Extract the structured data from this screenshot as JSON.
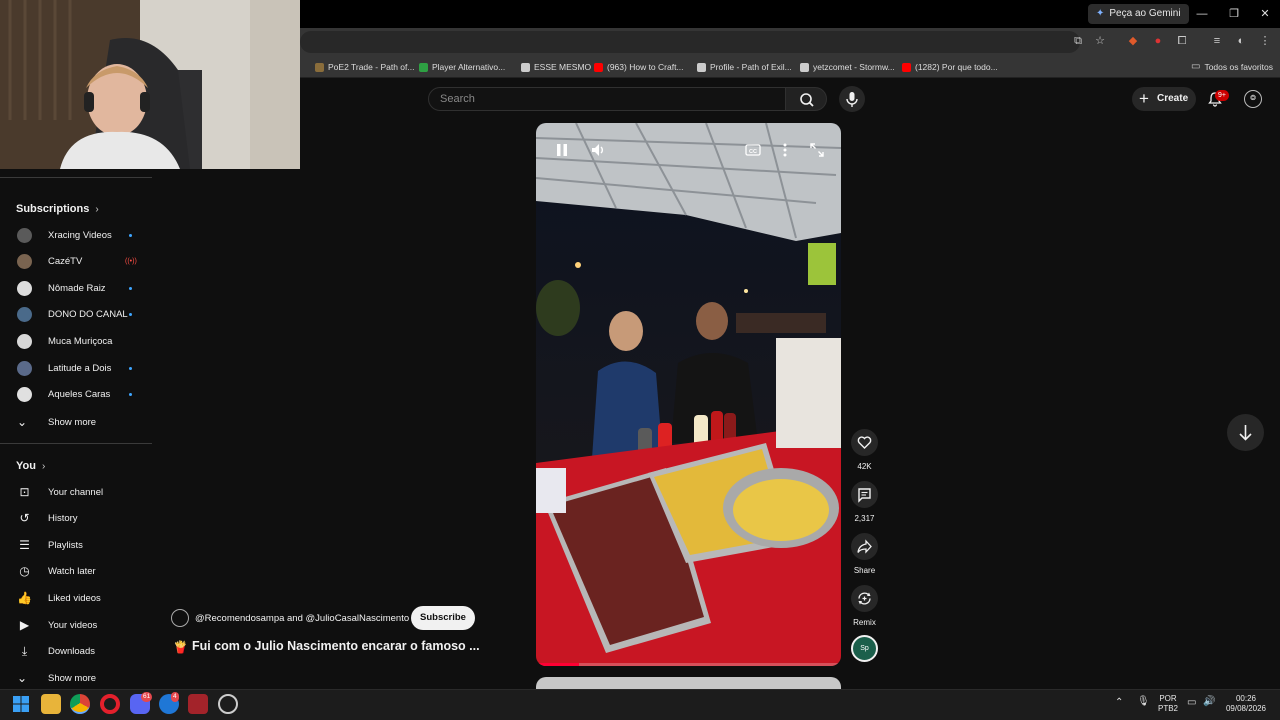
{
  "browser": {
    "gemini_label": "Peça ao Gemini",
    "all_favorites": "Todos os favoritos",
    "bookmarks": [
      {
        "label": "PoE2 Trade - Path of...",
        "color": "#8a6d3b"
      },
      {
        "label": "Player Alternativo...",
        "color": "#2ea043"
      },
      {
        "label": "ESSE MESMO",
        "color": "#cccccc"
      },
      {
        "label": "(963) How to Craft...",
        "color": "#ff0000"
      },
      {
        "label": "Profile - Path of Exil...",
        "color": "#cccccc"
      },
      {
        "label": "yetzcomet - Stormw...",
        "color": "#cccccc"
      },
      {
        "label": "(1282) Por que todo...",
        "color": "#ff0000"
      }
    ]
  },
  "header": {
    "search_placeholder": "Search",
    "create_label": "Create",
    "notifications_badge": "9+"
  },
  "sidebar": {
    "subscriptions_heading": "Subscriptions",
    "subscriptions": [
      {
        "label": "Xracing Videos",
        "indicator": "new"
      },
      {
        "label": "CazéTV",
        "indicator": "live"
      },
      {
        "label": "Nômade Raiz",
        "indicator": "new"
      },
      {
        "label": "DONO DO CANAL",
        "indicator": "new"
      },
      {
        "label": "Muca Muriçoca",
        "indicator": "none"
      },
      {
        "label": "Latitude a Dois",
        "indicator": "new"
      },
      {
        "label": "Aqueles Caras",
        "indicator": "new"
      }
    ],
    "subs_show_more": "Show more",
    "you_heading": "You",
    "you_items": [
      {
        "label": "Your channel",
        "icon": "user-box-icon"
      },
      {
        "label": "History",
        "icon": "history-icon"
      },
      {
        "label": "Playlists",
        "icon": "playlist-icon"
      },
      {
        "label": "Watch later",
        "icon": "clock-icon"
      },
      {
        "label": "Liked videos",
        "icon": "thumbs-up-icon"
      },
      {
        "label": "Your videos",
        "icon": "video-icon"
      },
      {
        "label": "Downloads",
        "icon": "download-icon"
      }
    ],
    "you_show_more": "Show more"
  },
  "short": {
    "channel_text": "@Recomendosampa and @JulioCasalNascimento",
    "subscribe_label": "Subscribe",
    "title": "Fui com o Julio Nascimento encarar o famoso ...",
    "title_emoji": "🍟",
    "likes": "42K",
    "comments": "2,317",
    "share_label": "Share",
    "remix_label": "Remix",
    "progress_fraction": 0.14
  },
  "taskbar": {
    "language_top": "POR",
    "language_bottom": "PTB2",
    "time": "00:26",
    "date": "09/08/2026",
    "discord_badge": "61",
    "app_badge": "4"
  }
}
